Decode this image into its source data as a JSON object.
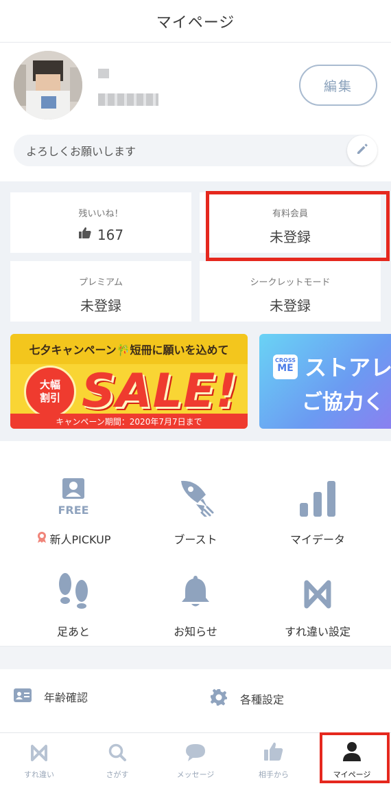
{
  "header": {
    "title": "マイページ"
  },
  "profile": {
    "edit_label": "編集",
    "intro_text": "よろしくお願いします"
  },
  "stats": {
    "likes": {
      "label": "残いいね！",
      "value": "167"
    },
    "paid": {
      "label": "有料会員",
      "value": "未登録"
    },
    "premium": {
      "label": "プレミアム",
      "value": "未登録"
    },
    "secret": {
      "label": "シークレットモード",
      "value": "未登録"
    }
  },
  "banners": {
    "sale": {
      "headline": "七夕キャンペーン🎋短冊に願いを込めて",
      "badge_line1": "大幅",
      "badge_line2": "割引",
      "big_text": "SALE!",
      "period": "キャンペーン期間：2020年7月7日まで"
    },
    "store": {
      "logo_top": "CROSS",
      "logo_bottom": "ME",
      "line1": "ストアレ",
      "line2": "ご協力く"
    }
  },
  "menu": {
    "pickup": {
      "badge": "FREE",
      "label": "新人PICKUP"
    },
    "boost": {
      "label": "ブースト"
    },
    "mydata": {
      "label": "マイデータ"
    },
    "footprints": {
      "label": "足あと"
    },
    "notices": {
      "label": "お知らせ"
    },
    "passby": {
      "label": "すれ違い設定"
    }
  },
  "settings": {
    "age": {
      "label": "年齢確認"
    },
    "general": {
      "label": "各種設定"
    }
  },
  "tabs": [
    {
      "label": "すれ違い",
      "icon": "cross-icon"
    },
    {
      "label": "さがす",
      "icon": "search-icon"
    },
    {
      "label": "メッセージ",
      "icon": "chat-icon"
    },
    {
      "label": "相手から",
      "icon": "thumbs-up-icon"
    },
    {
      "label": "マイページ",
      "icon": "person-icon"
    }
  ],
  "colors": {
    "accent_icon": "#8fa3be",
    "highlight": "#e5281e",
    "sale_red": "#ef3b2f",
    "sale_yellow": "#f9d534"
  }
}
